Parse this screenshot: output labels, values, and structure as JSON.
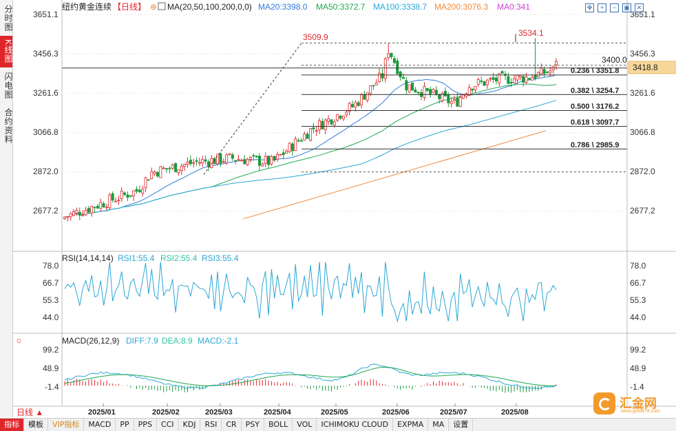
{
  "left_tabs": [
    "分时图",
    "K线图",
    "闪电图",
    "合约资料"
  ],
  "header": {
    "title": "纽约黄金连续",
    "period": "【日线】",
    "ma_label": "MA(20,50,100,200,0,0)",
    "ma_values": [
      {
        "label": "MA20:3398.0",
        "color": "#2f7bd8"
      },
      {
        "label": "MA50:3372.7",
        "color": "#1fa64f"
      },
      {
        "label": "MA100:3338.7",
        "color": "#29a6d6"
      },
      {
        "label": "MA200:3076.3",
        "color": "#f08a3c"
      },
      {
        "label": "MA0:341",
        "color": "#cc44cc"
      }
    ]
  },
  "window_icons": [
    "move-icon",
    "zoom-in-icon",
    "zoom-out-icon",
    "fit-icon",
    "close-icon"
  ],
  "price_axis": {
    "ticks": [
      "3651.1",
      "3456.3",
      "3261.6",
      "3066.8",
      "2872.0",
      "2677.2"
    ],
    "current": "3418.8"
  },
  "annotations": {
    "high1": "3509.9",
    "high2": "3534.1",
    "level_line": "3400.0"
  },
  "fibonacci": [
    {
      "label": "0.236 \\ 3351.8",
      "value": 3351.8
    },
    {
      "label": "0.382 \\ 3254.7",
      "value": 3254.7
    },
    {
      "label": "0.500 \\ 3176.2",
      "value": 3176.2
    },
    {
      "label": "0.618 \\ 3097.7",
      "value": 3097.7
    },
    {
      "label": "0.786 \\ 2985.9",
      "value": 2985.9
    }
  ],
  "rsi": {
    "title": "RSI(14,14,14)",
    "rsi1": "RSI1:55.4",
    "rsi2": "RSI2:55.4",
    "rsi3": "RSI3:55.4",
    "ticks": [
      "78.0",
      "66.7",
      "55.3",
      "44.0"
    ]
  },
  "macd": {
    "title": "MACD(26,12,9)",
    "diff": "DIFF:7.9",
    "dea": "DEA:8.9",
    "macd": "MACD:-2.1",
    "ticks": [
      "99.2",
      "48.9",
      "-1.4"
    ]
  },
  "x_labels": [
    "2025/01",
    "2025/02",
    "2025/03",
    "2025/04",
    "2025/05",
    "2025/06",
    "2025/07",
    "2025/08"
  ],
  "period_button": "日线 ▲",
  "bottom_tabs": [
    "指标",
    "模板",
    "VIP指标",
    "MACD",
    "PP",
    "PPS",
    "CCI",
    "KDJ",
    "RSI",
    "CR",
    "PSY",
    "BOLL",
    "VOL",
    "ICHIMOKU CLOUD",
    "EXPMA",
    "MA",
    "设置"
  ],
  "watermark": {
    "name": "汇金网",
    "url": "www.gold678.com"
  },
  "chart_data": {
    "type": "candlestick",
    "price_range": [
      2600,
      3700
    ],
    "key_points": [
      {
        "x": "2025/01",
        "close": 2650
      },
      {
        "x": "2025/02",
        "close": 2880
      },
      {
        "x": "2025/03",
        "close": 2920
      },
      {
        "x": "2025/04",
        "close": 3350
      },
      {
        "x": "2025/04",
        "high": 3509.9
      },
      {
        "x": "2025/05",
        "close": 3200
      },
      {
        "x": "2025/06",
        "close": 3400
      },
      {
        "x": "2025/07",
        "close": 3380
      },
      {
        "x": "2025/08",
        "high": 3534.1
      },
      {
        "x": "2025/08",
        "close": 3418.8
      }
    ],
    "ma_last": {
      "MA20": 3398.0,
      "MA50": 3372.7,
      "MA100": 3338.7,
      "MA200": 3076.3
    },
    "rsi_last": 55.4,
    "macd_last": {
      "DIFF": 7.9,
      "DEA": 8.9,
      "MACD": -2.1
    }
  }
}
